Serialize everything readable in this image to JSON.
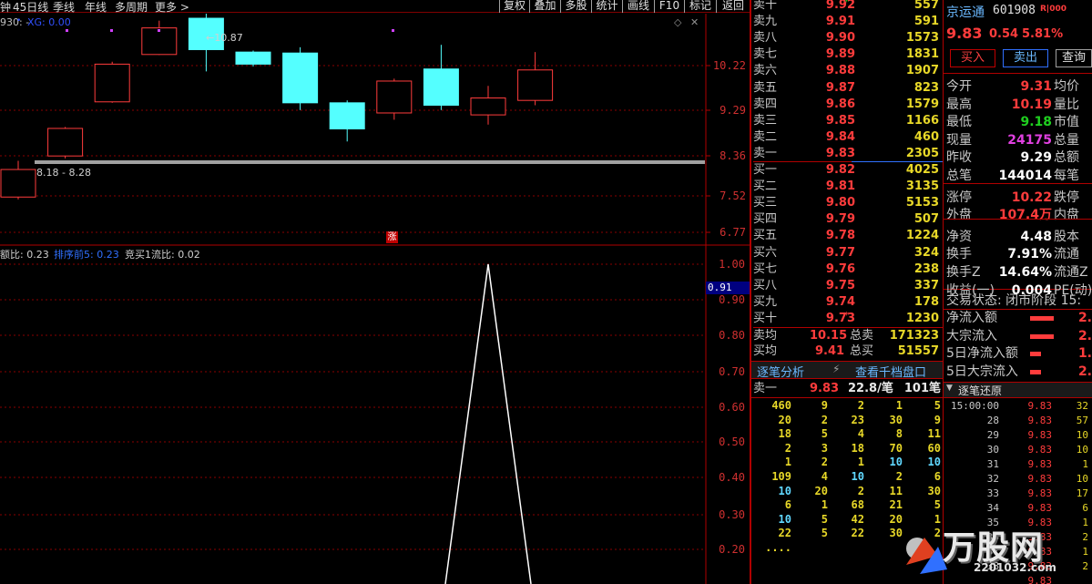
{
  "toolbar": {
    "left_tabs": [
      "钟",
      "45日线",
      "季线",
      "年线",
      "多周期",
      "更多 >"
    ],
    "right_buttons": [
      "复权",
      "叠加",
      "多股",
      "统计",
      "画线",
      "F10",
      "标记",
      "返回"
    ]
  },
  "kchart": {
    "indicator_label": "930: -",
    "indicator_xg": "XG: 0.00",
    "high_annotation": "10.87",
    "low_annotation": "8.18 - 8.28",
    "price_scale": [
      "10.22",
      "9.29",
      "8.36",
      "7.52",
      "6.77"
    ],
    "zhang_badge": "涨"
  },
  "subchart": {
    "label1": "额比: 0.23",
    "label2": "排序前5: 0.23",
    "label3": "竞买1流比: 0.02",
    "scale": [
      "1.00",
      "0.90",
      "0.80",
      "0.70",
      "0.60",
      "0.50",
      "0.40",
      "0.30",
      "0.20"
    ],
    "current_value": "0.91"
  },
  "candles": [
    {
      "o": 7.5,
      "c": 8.07,
      "h": 8.25,
      "l": 7.45
    },
    {
      "o": 8.35,
      "c": 8.92,
      "h": 8.95,
      "l": 8.3
    },
    {
      "o": 9.47,
      "c": 10.25,
      "h": 10.3,
      "l": 9.45
    },
    {
      "o": 10.45,
      "c": 11.0,
      "h": 11.15,
      "l": 10.44
    },
    {
      "o": 11.2,
      "c": 10.55,
      "h": 11.35,
      "l": 10.1
    },
    {
      "o": 10.5,
      "c": 10.25,
      "h": 10.53,
      "l": 10.2
    },
    {
      "o": 10.48,
      "c": 9.45,
      "h": 10.6,
      "l": 9.3
    },
    {
      "o": 9.45,
      "c": 8.91,
      "h": 9.5,
      "l": 8.65
    },
    {
      "o": 9.24,
      "c": 9.9,
      "h": 9.95,
      "l": 9.1
    },
    {
      "o": 10.15,
      "c": 9.4,
      "h": 10.65,
      "l": 9.3
    },
    {
      "o": 9.2,
      "c": 9.55,
      "h": 9.8,
      "l": 9.0
    },
    {
      "o": 9.5,
      "c": 10.13,
      "h": 10.5,
      "l": 9.4
    }
  ],
  "quote": {
    "sell": [
      {
        "label": "卖十",
        "price": "9.92",
        "vol": "557",
        "mark": "*"
      },
      {
        "label": "卖九",
        "price": "9.91",
        "vol": "591"
      },
      {
        "label": "卖八",
        "price": "9.90",
        "vol": "1573"
      },
      {
        "label": "卖七",
        "price": "9.89",
        "vol": "1831"
      },
      {
        "label": "卖六",
        "price": "9.88",
        "vol": "1907"
      },
      {
        "label": "卖五",
        "price": "9.87",
        "vol": "823"
      },
      {
        "label": "卖四",
        "price": "9.86",
        "vol": "1579"
      },
      {
        "label": "卖三",
        "price": "9.85",
        "vol": "1166"
      },
      {
        "label": "卖二",
        "price": "9.84",
        "vol": "460"
      },
      {
        "label": "卖一",
        "price": "9.83",
        "vol": "2305"
      }
    ],
    "buy": [
      {
        "label": "买一",
        "price": "9.82",
        "vol": "4025"
      },
      {
        "label": "买二",
        "price": "9.81",
        "vol": "3135"
      },
      {
        "label": "买三",
        "price": "9.80",
        "vol": "5153"
      },
      {
        "label": "买四",
        "price": "9.79",
        "vol": "507"
      },
      {
        "label": "买五",
        "price": "9.78",
        "vol": "1224"
      },
      {
        "label": "买六",
        "price": "9.77",
        "vol": "324"
      },
      {
        "label": "买七",
        "price": "9.76",
        "vol": "238"
      },
      {
        "label": "买八",
        "price": "9.75",
        "vol": "337"
      },
      {
        "label": "买九",
        "price": "9.74",
        "vol": "178"
      },
      {
        "label": "买十",
        "price": "9.73",
        "vol": "1230",
        "mark": "*"
      }
    ],
    "sell_avg_label": "卖均",
    "sell_avg": "10.15",
    "total_sell_label": "总卖",
    "total_sell": "171323",
    "buy_avg_label": "买均",
    "buy_avg": "9.41",
    "total_buy_label": "总买",
    "total_buy": "51557",
    "tab_tick": "逐笔分析",
    "tab_depth": "查看千档盘口",
    "sell1_label": "卖一",
    "sell1_price": "9.83",
    "sell1_avg": "22.8/笔",
    "sell1_count": "101笔"
  },
  "ticks": {
    "rows": [
      [
        "460",
        "9",
        "2",
        "1",
        "5"
      ],
      [
        "20",
        "2",
        "23",
        "30",
        "9"
      ],
      [
        "18",
        "5",
        "4",
        "8",
        "11"
      ],
      [
        "2",
        "3",
        "18",
        "70",
        "60"
      ],
      [
        "1",
        "2",
        "1",
        "10",
        "10"
      ],
      [
        "109",
        "4",
        "10",
        "2",
        "6"
      ],
      [
        "10",
        "20",
        "2",
        "11",
        "30"
      ],
      [
        "6",
        "1",
        "68",
        "21",
        "5"
      ],
      [
        "10",
        "5",
        "42",
        "20",
        "1"
      ],
      [
        "22",
        "5",
        "22",
        "30",
        "2"
      ],
      [
        "....",
        "",
        "",
        "",
        ""
      ]
    ]
  },
  "stock": {
    "name": "京运通",
    "code": "601908",
    "badge": "R|000",
    "price": "9.83",
    "change": "0.54",
    "pct": "5.81%",
    "buy_btn": "买入",
    "sell_btn": "卖出",
    "query_btn": "查询"
  },
  "info": [
    {
      "l": "今开",
      "v": "9.31",
      "c": "up",
      "l2": "均价"
    },
    {
      "l": "最高",
      "v": "10.19",
      "c": "up",
      "l2": "量比"
    },
    {
      "l": "最低",
      "v": "9.18",
      "c": "dn",
      "l2": "市值"
    },
    {
      "l": "现量",
      "v": "24175",
      "c": "mag",
      "l2": "总量"
    },
    {
      "l": "昨收",
      "v": "9.29",
      "c": "wht",
      "l2": "总额"
    },
    {
      "l": "总笔",
      "v": "144014",
      "c": "wht",
      "l2": "每笔"
    },
    {
      "l": "涨停",
      "v": "10.22",
      "c": "up",
      "l2": "跌停"
    },
    {
      "l": "外盘",
      "v": "107.4万",
      "c": "up",
      "l2": "内盘"
    },
    {
      "l": "净资",
      "v": "4.48",
      "c": "wht",
      "l2": "股本"
    },
    {
      "l": "换手",
      "v": "7.91%",
      "c": "wht",
      "l2": "流通"
    },
    {
      "l": "换手Z",
      "v": "14.64%",
      "c": "wht",
      "l2": "流通Z"
    },
    {
      "l": "收益(一)",
      "v": "0.004",
      "c": "wht",
      "l2": "PE(动)"
    }
  ],
  "trade_status": "交易状态: 闭市阶段 15:",
  "flows": [
    {
      "l": "净流入额",
      "v": "2."
    },
    {
      "l": "大宗流入",
      "v": "2."
    },
    {
      "l": "5日净流入额",
      "v": "1."
    },
    {
      "l": "5日大宗流入",
      "v": "2."
    }
  ],
  "replay": {
    "title": "逐笔还原",
    "rows": [
      [
        "15:00:00",
        "9.83",
        "32"
      ],
      [
        "28",
        "9.83",
        "57"
      ],
      [
        "29",
        "9.83",
        "10"
      ],
      [
        "30",
        "9.83",
        "10"
      ],
      [
        "31",
        "9.83",
        "1"
      ],
      [
        "32",
        "9.83",
        "10"
      ],
      [
        "33",
        "9.83",
        "17"
      ],
      [
        "34",
        "9.83",
        "6"
      ],
      [
        "35",
        "9.83",
        "1"
      ],
      [
        "36",
        "9.83",
        "2"
      ],
      [
        "37",
        "9.83",
        "1"
      ],
      [
        "38",
        "9.83",
        "2"
      ],
      [
        "",
        "9.83",
        ""
      ]
    ]
  },
  "watermark": {
    "text": "万股网",
    "sub": "2201032.com"
  },
  "colors": {
    "up": "#ff3c3c",
    "down_fill": "#54ffff",
    "grid": "#b00000",
    "volume": "#e8d828"
  }
}
